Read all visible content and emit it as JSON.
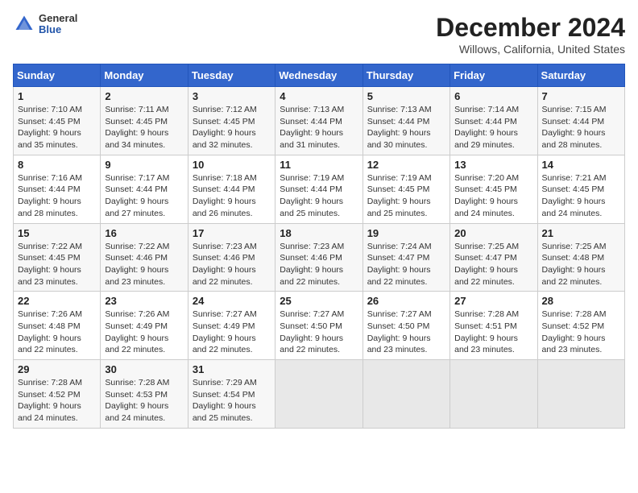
{
  "logo": {
    "general": "General",
    "blue": "Blue"
  },
  "title": "December 2024",
  "subtitle": "Willows, California, United States",
  "days_of_week": [
    "Sunday",
    "Monday",
    "Tuesday",
    "Wednesday",
    "Thursday",
    "Friday",
    "Saturday"
  ],
  "weeks": [
    [
      {
        "day": 1,
        "sunrise": "7:10 AM",
        "sunset": "4:45 PM",
        "daylight": "9 hours and 35 minutes."
      },
      {
        "day": 2,
        "sunrise": "7:11 AM",
        "sunset": "4:45 PM",
        "daylight": "9 hours and 34 minutes."
      },
      {
        "day": 3,
        "sunrise": "7:12 AM",
        "sunset": "4:45 PM",
        "daylight": "9 hours and 32 minutes."
      },
      {
        "day": 4,
        "sunrise": "7:13 AM",
        "sunset": "4:44 PM",
        "daylight": "9 hours and 31 minutes."
      },
      {
        "day": 5,
        "sunrise": "7:13 AM",
        "sunset": "4:44 PM",
        "daylight": "9 hours and 30 minutes."
      },
      {
        "day": 6,
        "sunrise": "7:14 AM",
        "sunset": "4:44 PM",
        "daylight": "9 hours and 29 minutes."
      },
      {
        "day": 7,
        "sunrise": "7:15 AM",
        "sunset": "4:44 PM",
        "daylight": "9 hours and 28 minutes."
      }
    ],
    [
      {
        "day": 8,
        "sunrise": "7:16 AM",
        "sunset": "4:44 PM",
        "daylight": "9 hours and 28 minutes."
      },
      {
        "day": 9,
        "sunrise": "7:17 AM",
        "sunset": "4:44 PM",
        "daylight": "9 hours and 27 minutes."
      },
      {
        "day": 10,
        "sunrise": "7:18 AM",
        "sunset": "4:44 PM",
        "daylight": "9 hours and 26 minutes."
      },
      {
        "day": 11,
        "sunrise": "7:19 AM",
        "sunset": "4:44 PM",
        "daylight": "9 hours and 25 minutes."
      },
      {
        "day": 12,
        "sunrise": "7:19 AM",
        "sunset": "4:45 PM",
        "daylight": "9 hours and 25 minutes."
      },
      {
        "day": 13,
        "sunrise": "7:20 AM",
        "sunset": "4:45 PM",
        "daylight": "9 hours and 24 minutes."
      },
      {
        "day": 14,
        "sunrise": "7:21 AM",
        "sunset": "4:45 PM",
        "daylight": "9 hours and 24 minutes."
      }
    ],
    [
      {
        "day": 15,
        "sunrise": "7:22 AM",
        "sunset": "4:45 PM",
        "daylight": "9 hours and 23 minutes."
      },
      {
        "day": 16,
        "sunrise": "7:22 AM",
        "sunset": "4:46 PM",
        "daylight": "9 hours and 23 minutes."
      },
      {
        "day": 17,
        "sunrise": "7:23 AM",
        "sunset": "4:46 PM",
        "daylight": "9 hours and 22 minutes."
      },
      {
        "day": 18,
        "sunrise": "7:23 AM",
        "sunset": "4:46 PM",
        "daylight": "9 hours and 22 minutes."
      },
      {
        "day": 19,
        "sunrise": "7:24 AM",
        "sunset": "4:47 PM",
        "daylight": "9 hours and 22 minutes."
      },
      {
        "day": 20,
        "sunrise": "7:25 AM",
        "sunset": "4:47 PM",
        "daylight": "9 hours and 22 minutes."
      },
      {
        "day": 21,
        "sunrise": "7:25 AM",
        "sunset": "4:48 PM",
        "daylight": "9 hours and 22 minutes."
      }
    ],
    [
      {
        "day": 22,
        "sunrise": "7:26 AM",
        "sunset": "4:48 PM",
        "daylight": "9 hours and 22 minutes."
      },
      {
        "day": 23,
        "sunrise": "7:26 AM",
        "sunset": "4:49 PM",
        "daylight": "9 hours and 22 minutes."
      },
      {
        "day": 24,
        "sunrise": "7:27 AM",
        "sunset": "4:49 PM",
        "daylight": "9 hours and 22 minutes."
      },
      {
        "day": 25,
        "sunrise": "7:27 AM",
        "sunset": "4:50 PM",
        "daylight": "9 hours and 22 minutes."
      },
      {
        "day": 26,
        "sunrise": "7:27 AM",
        "sunset": "4:50 PM",
        "daylight": "9 hours and 23 minutes."
      },
      {
        "day": 27,
        "sunrise": "7:28 AM",
        "sunset": "4:51 PM",
        "daylight": "9 hours and 23 minutes."
      },
      {
        "day": 28,
        "sunrise": "7:28 AM",
        "sunset": "4:52 PM",
        "daylight": "9 hours and 23 minutes."
      }
    ],
    [
      {
        "day": 29,
        "sunrise": "7:28 AM",
        "sunset": "4:52 PM",
        "daylight": "9 hours and 24 minutes."
      },
      {
        "day": 30,
        "sunrise": "7:28 AM",
        "sunset": "4:53 PM",
        "daylight": "9 hours and 24 minutes."
      },
      {
        "day": 31,
        "sunrise": "7:29 AM",
        "sunset": "4:54 PM",
        "daylight": "9 hours and 25 minutes."
      },
      null,
      null,
      null,
      null
    ]
  ]
}
